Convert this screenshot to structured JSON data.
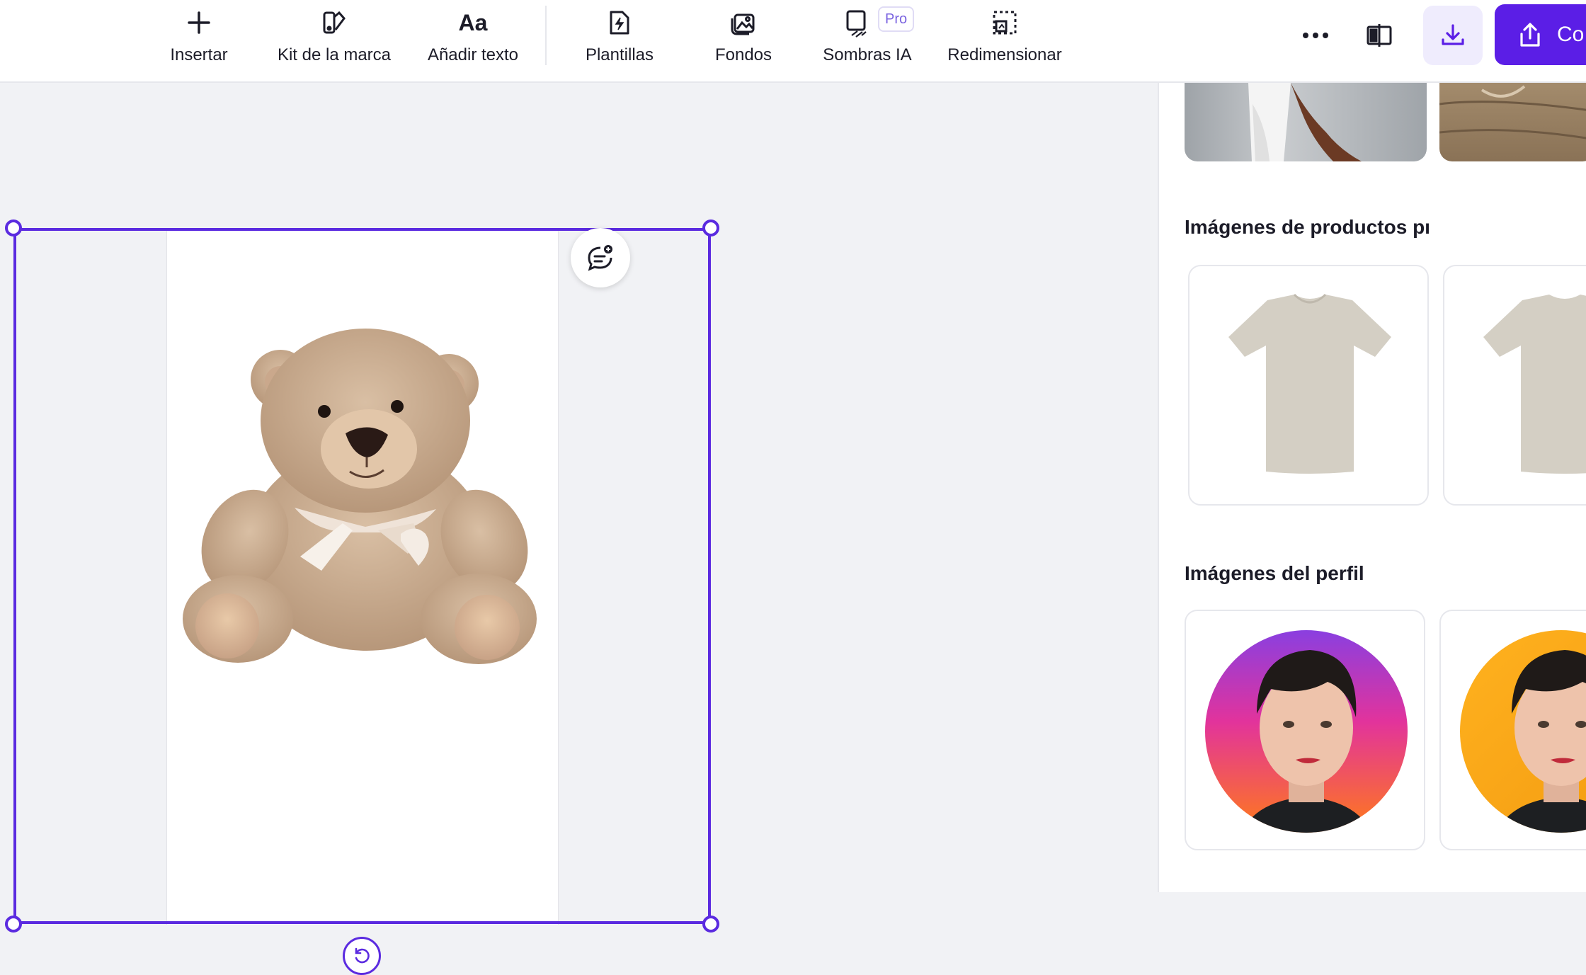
{
  "toolbar": {
    "items": [
      {
        "label": "Insertar",
        "icon": "plus-icon"
      },
      {
        "label": "Kit de la marca",
        "icon": "brand-kit-icon"
      },
      {
        "label": "Añadir texto",
        "icon": "text-aa-icon"
      },
      {
        "label": "Plantillas",
        "icon": "template-bolt-icon"
      },
      {
        "label": "Fondos",
        "icon": "backgrounds-icon"
      },
      {
        "label": "Sombras IA",
        "icon": "shadow-icon"
      },
      {
        "label": "Redimensionar",
        "icon": "resize-icon"
      }
    ],
    "pro_badge": "Pro",
    "share_label": "Co"
  },
  "panel": {
    "section_products": "Imágenes de productos pı",
    "section_profile": "Imágenes del perfil"
  },
  "colors": {
    "accent": "#5b1ee6",
    "selection": "#5b2be0",
    "canvas_bg": "#f1f2f5"
  }
}
